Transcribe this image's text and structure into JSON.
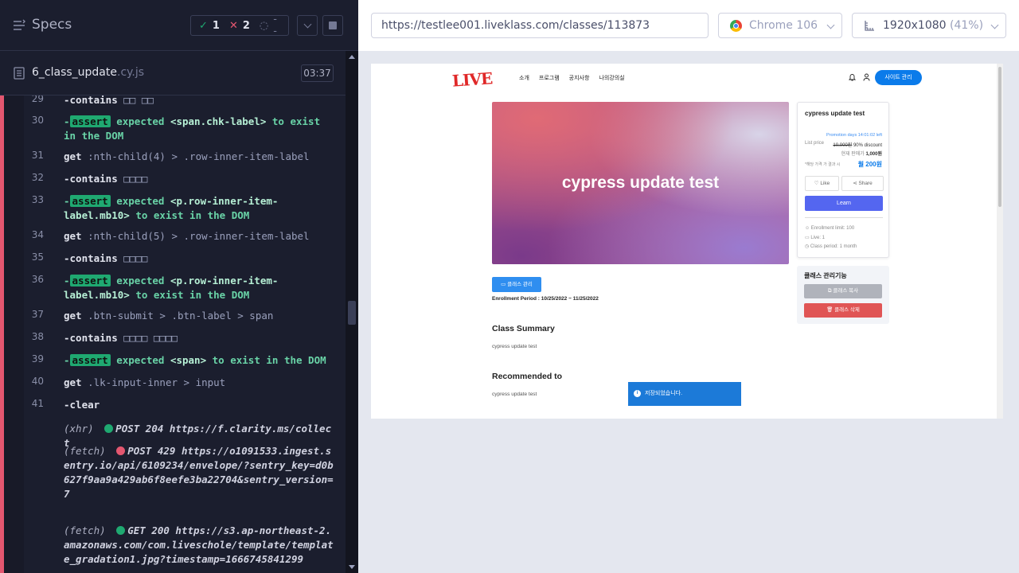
{
  "runner": {
    "title": "Specs",
    "stats": {
      "passed": "1",
      "failed": "2",
      "pending": "--"
    },
    "spec_file": {
      "name": "6_class_update",
      "ext": ".cy.js",
      "duration": "03:37"
    }
  },
  "commands": [
    {
      "num": "29",
      "name": "-contains",
      "msg": "□□ □□"
    },
    {
      "num": "30",
      "badge": "assert",
      "text": "expected ",
      "el": "<span.chk-label>",
      "text2": " to exist in the DOM"
    },
    {
      "num": "31",
      "name": "get",
      "msg": ":nth-child(4) > .row-inner-item-label"
    },
    {
      "num": "32",
      "name": "-contains",
      "msg": "□□□□"
    },
    {
      "num": "33",
      "badge": "assert",
      "text": "expected ",
      "el": "<p.row-inner-item-label.mb10>",
      "text2": " to exist in the DOM"
    },
    {
      "num": "34",
      "name": "get",
      "msg": ":nth-child(5) > .row-inner-item-label"
    },
    {
      "num": "35",
      "name": "-contains",
      "msg": "□□□□"
    },
    {
      "num": "36",
      "badge": "assert",
      "text": "expected ",
      "el": "<p.row-inner-item-label.mb10>",
      "text2": " to exist in the DOM"
    },
    {
      "num": "37",
      "name": "get",
      "msg": ".btn-submit > .btn-label > span"
    },
    {
      "num": "38",
      "name": "-contains",
      "msg": "□□□□ □□□□"
    },
    {
      "num": "39",
      "badge": "assert",
      "text": "expected ",
      "el": "<span>",
      "text2": " to exist in the DOM"
    },
    {
      "num": "40",
      "name": "get",
      "msg": ".lk-input-inner > input"
    },
    {
      "num": "41",
      "name": "-clear",
      "msg": ""
    }
  ],
  "requests": [
    {
      "kind": "(xhr)",
      "status": "ok",
      "text": "POST 204 https://f.clarity.ms/collect"
    },
    {
      "kind": "(fetch)",
      "status": "bad",
      "text": "POST 429 https://o1091533.ingest.sentry.io/api/6109234/envelope/?sentry_key=d0b627f9aa9a429ab6f8eefe3ba22704&sentry_version=7"
    },
    {
      "kind": "(fetch)",
      "status": "ok",
      "text": "GET 200 https://s3.ap-northeast-2.amazonaws.com/com.liveschole/template/template_gradation1.jpg?timestamp=1666745841299"
    }
  ],
  "aut_header": {
    "url": "https://testlee001.liveklass.com/classes/113873",
    "browser": "Chrome 106",
    "viewport": "1920x1080",
    "zoom": "(41%)"
  },
  "site": {
    "logo": "LIVE",
    "nav": [
      "소개",
      "프로그램",
      "공지사항",
      "나의강의실"
    ],
    "admin_button": "사이트 관리",
    "hero_title": "cypress update test",
    "class_admin_button": "클래스 관리",
    "enroll_period": "Enrollment Period : 10/25/2022 ~ 11/25/2022",
    "summary_heading": "Class Summary",
    "summary_text": "cypress update test",
    "recommended_heading": "Recommended to",
    "recommended_text": "cypress update test",
    "toast": "저장되었습니다.",
    "card": {
      "title": "cypress update test",
      "promo": "Promotion days 14:01:02 left",
      "listprice_label": "List price",
      "listprice": "10,000원",
      "discount": "90% discount",
      "total_label": "현재 판매가",
      "total": "1,000원",
      "monthly_label": "*해당 가격 가 결과 시",
      "monthly": "월 200원",
      "like": "Like",
      "share": "Share",
      "learn": "Learn",
      "enroll_limit": "Enrollment limit: 100",
      "live": "Live: 1",
      "class_period": "Class period: 1 month"
    },
    "manage": {
      "title": "클래스 관리기능",
      "copy": "클래스 복사",
      "delete": "클래스 삭제"
    }
  }
}
